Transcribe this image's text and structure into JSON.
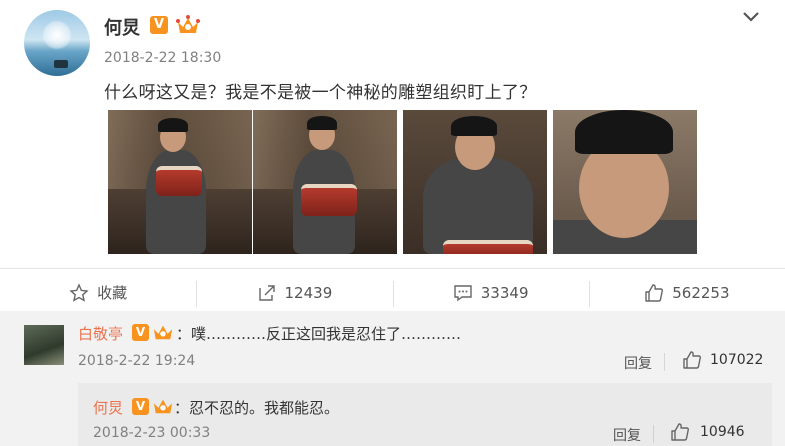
{
  "post": {
    "author": "何炅",
    "verified_badge": "V",
    "timestamp": "2018-2-22 18:30",
    "text": "什么呀这又是？我是不是被一个神秘的雕塑组织盯上了？",
    "images": [
      "wax-figure-drummer-1",
      "wax-figure-drummer-2",
      "wax-figure-drummer-closeup",
      "wax-figure-face-closeup"
    ]
  },
  "actions": {
    "favorite_label": "收藏",
    "repost_count": "12439",
    "comment_count": "33349",
    "like_count": "562253"
  },
  "comment": {
    "author": "白敬亭",
    "verified_badge": "V",
    "text": "：噗…………反正这回我是忍住了…………",
    "timestamp": "2018-2-22 19:24",
    "reply_label": "回复",
    "like_count": "107022"
  },
  "reply": {
    "author": "何炅",
    "verified_badge": "V",
    "text": "：忍不忍的。我都能忍。",
    "timestamp": "2018-2-23 00:33",
    "reply_label": "回复",
    "like_count": "10946"
  },
  "colors": {
    "name_orange": "#eb7350",
    "badge_orange": "#f7931e",
    "comment_bg": "#f2f2f2",
    "reply_bg": "#eaeaea"
  }
}
